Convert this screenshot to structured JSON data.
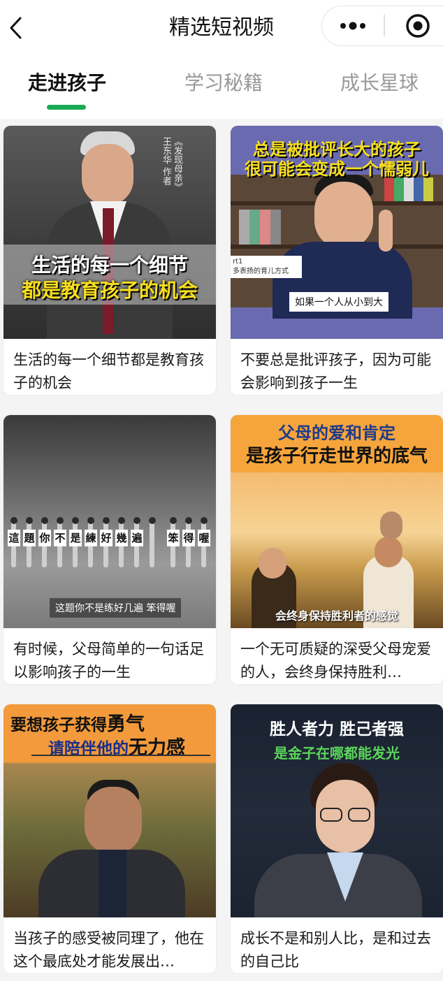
{
  "header": {
    "title": "精选短视频",
    "back_icon": "chevron-left-icon",
    "more_icon": "more-dots-icon",
    "close_icon": "target-circle-icon"
  },
  "tabs": [
    {
      "label": "走进孩子",
      "active": true
    },
    {
      "label": "学习秘籍",
      "active": false
    },
    {
      "label": "成长星球",
      "active": false
    }
  ],
  "accent_color": "#1aaa55",
  "cards": [
    {
      "title": "生活的每一个细节都是教育孩子的机会",
      "overlay_line1": "生活的每一个细节",
      "overlay_line2": "都是教育孩子的机会",
      "side_caption_book": "《发现母亲》",
      "side_caption_author": "王东华 作者"
    },
    {
      "title": "不要总是批评孩子，因为可能会影响到孩子一生",
      "overlay_line1": "总是被批评长大的孩子",
      "overlay_line2": "很可能会变成一个懦弱儿",
      "subtitle": "如果一个人从小到大",
      "side_tag": "rt1",
      "side_tag_2": "多表扬的育儿方式"
    },
    {
      "title": "有时候，父母简单的一句话足以影响孩子的一生",
      "signs": [
        "這",
        "題",
        "你",
        "不",
        "是",
        "練",
        "好",
        "幾",
        "遍",
        "",
        "笨",
        "得",
        "喔"
      ],
      "subtitle": "这题你不是练好几遍 笨得喔"
    },
    {
      "title": "一个无可质疑的深受父母宠爱的人，会终身保持胜利…",
      "overlay_line1": "父母的爱和肯定",
      "overlay_line2": "是孩子行走世界的底气",
      "subtitle": "会终身保持胜利者的感觉"
    },
    {
      "title": "当孩子的感受被同理了，他在这个最底处才能发展出…",
      "overlay_line1a": "要想孩子获得",
      "overlay_line1b": "勇气",
      "overlay_line2a": "请陪伴他的",
      "overlay_line2b": "无力感"
    },
    {
      "title": "成长不是和别人比，是和过去的自己比",
      "overlay_line1": "胜人者力 胜己者强",
      "overlay_line2": "是金子在哪都能发光"
    }
  ]
}
